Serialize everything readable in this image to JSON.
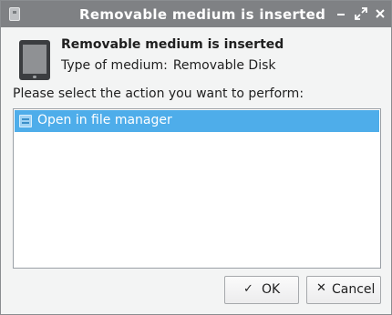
{
  "window": {
    "title": "Removable medium is inserted",
    "controls": [
      "minimize-icon",
      "maximize-icon",
      "close-icon"
    ]
  },
  "header": {
    "icon": "removable-device-icon",
    "title": "Removable medium is inserted",
    "type_label": "Type of medium:",
    "type_value": "Removable Disk"
  },
  "prompt": "Please select the action you want to perform:",
  "actions": [
    {
      "label": "Open in file manager",
      "icon": "file-manager-icon",
      "selected": true
    }
  ],
  "buttons": {
    "ok_label": "OK",
    "ok_icon": "✓",
    "cancel_label": "Cancel",
    "cancel_icon": "✕"
  },
  "colors": {
    "titlebar": "#7f8184",
    "selection": "#4eadea",
    "background": "#f3f4f4"
  }
}
